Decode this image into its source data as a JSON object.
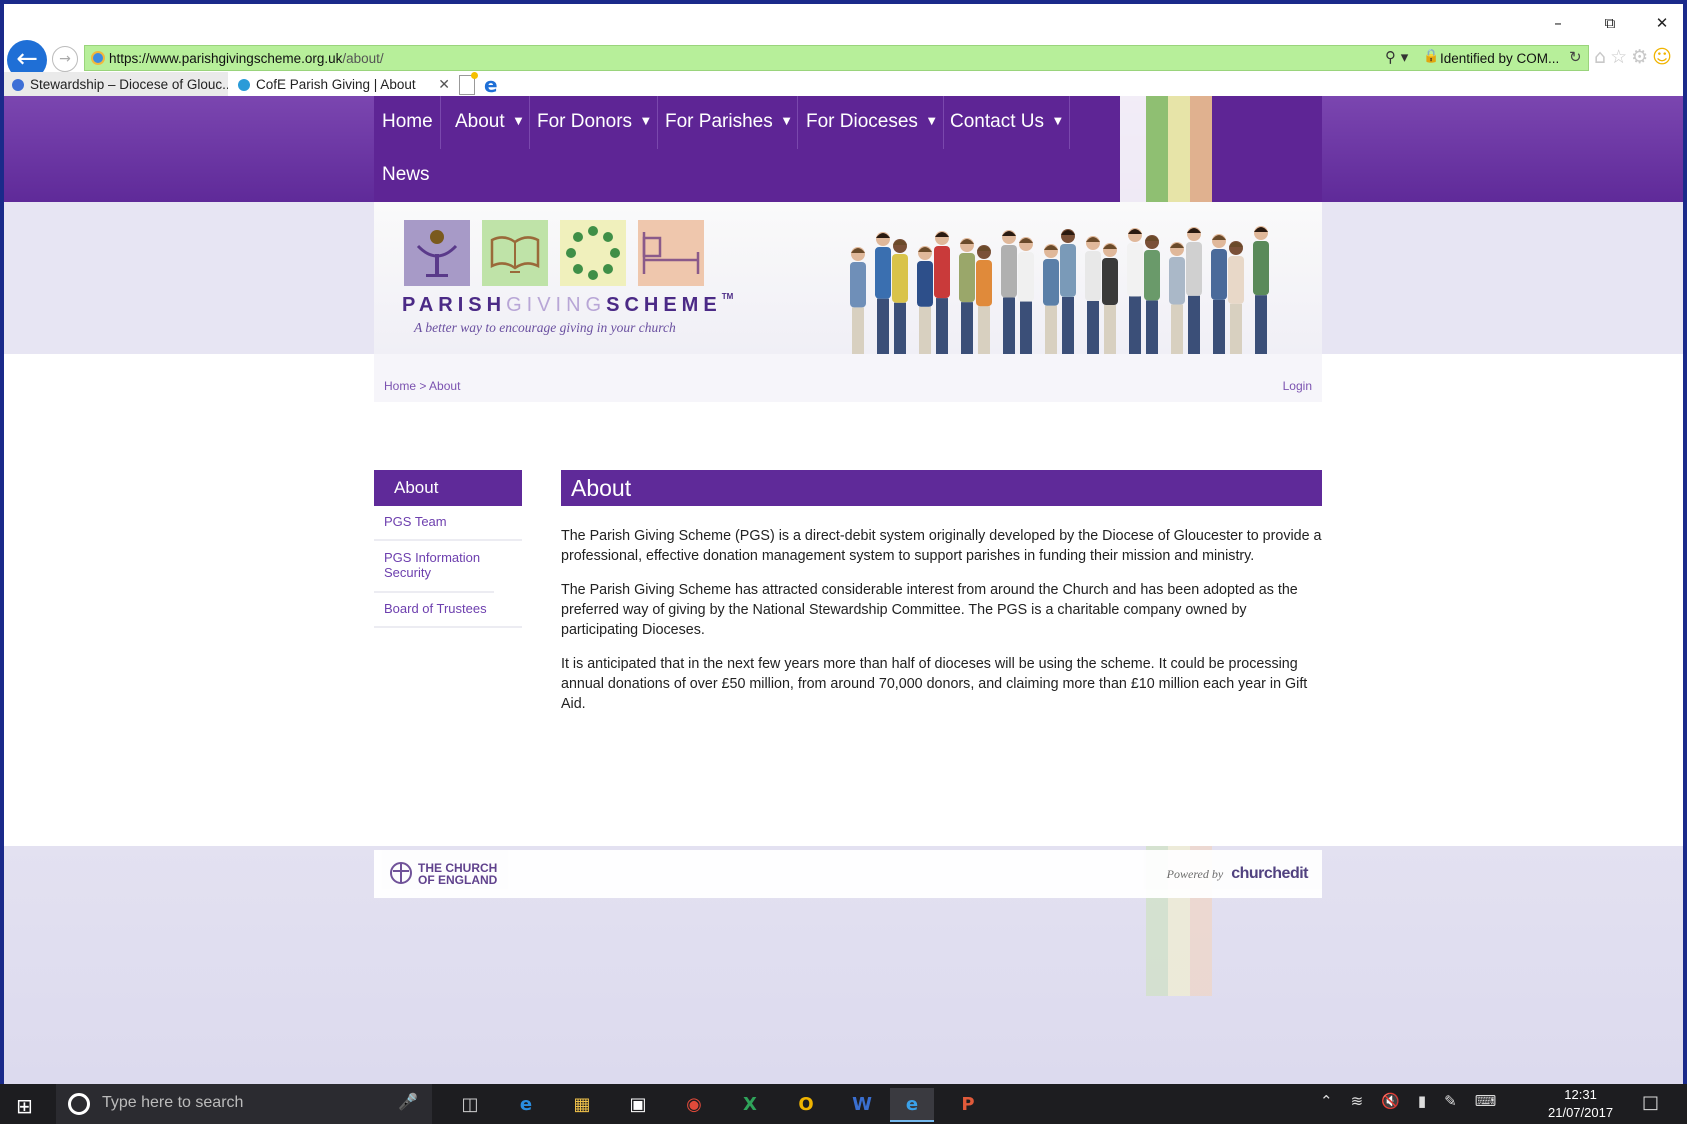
{
  "browser": {
    "url_host": "https://www.parishgivingscheme.org.uk",
    "url_path": "/about/",
    "identity": "Identified by COM...",
    "tabs": [
      {
        "label": "Stewardship – Diocese of Glouc...",
        "active": false
      },
      {
        "label": "CofE Parish Giving | About",
        "active": true
      }
    ]
  },
  "nav": {
    "items": [
      {
        "label": "Home",
        "has_caret": false
      },
      {
        "label": "About",
        "has_caret": true
      },
      {
        "label": "For Donors",
        "has_caret": true
      },
      {
        "label": "For Parishes",
        "has_caret": true
      },
      {
        "label": "For Dioceses",
        "has_caret": true
      },
      {
        "label": "Contact Us",
        "has_caret": true
      },
      {
        "label": "News",
        "has_caret": false
      }
    ]
  },
  "header": {
    "brand_dark1": "PARISH",
    "brand_light": "GIVING",
    "brand_dark2": "SCHEME",
    "tm": "TM",
    "tagline": "A better way to encourage giving in your church"
  },
  "breadcrumb": {
    "home": "Home",
    "sep": ">",
    "current": "About",
    "login": "Login"
  },
  "sidebar": {
    "title": "About",
    "items": [
      "PGS Team",
      "PGS Information Security",
      "Board of Trustees"
    ]
  },
  "main": {
    "title": "About",
    "paragraphs": [
      "The Parish Giving Scheme (PGS) is a direct-debit system originally developed by the Diocese of Gloucester to provide a professional, effective donation management system to support parishes in funding their mission and ministry.",
      "The Parish Giving Scheme has attracted considerable interest from around the Church and has been adopted as the preferred way of giving by the National Stewardship Committee. The PGS is a charitable company owned by participating Dioceses.",
      "It is anticipated that in the next few years more than half of dioceses will be using the scheme. It could be processing annual donations of over £50 million, from around 70,000 donors, and claiming more than £10 million each year in Gift Aid."
    ]
  },
  "footer": {
    "coe_line1": "THE CHURCH",
    "coe_line2": "OF ENGLAND",
    "powered_by": "Powered by",
    "platform": "churchedit"
  },
  "taskbar": {
    "search_placeholder": "Type here to search",
    "time": "12:31",
    "date": "21/07/2017"
  },
  "colors": {
    "brand_purple": "#5f2a99",
    "address_green": "#b7ef9a"
  }
}
